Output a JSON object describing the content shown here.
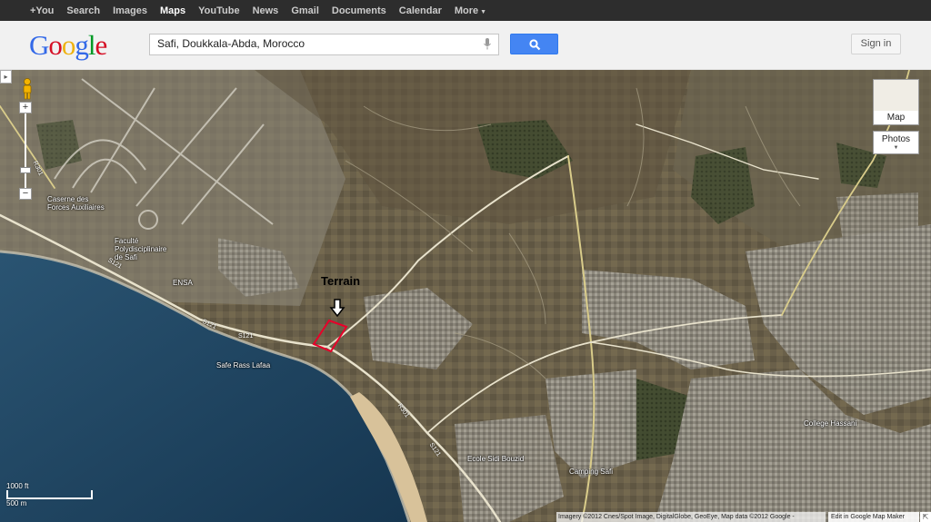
{
  "topbar": {
    "items": [
      "+You",
      "Search",
      "Images",
      "Maps",
      "YouTube",
      "News",
      "Gmail",
      "Documents",
      "Calendar",
      "More"
    ],
    "active": "Maps"
  },
  "header": {
    "logo_letters": [
      {
        "ch": "G",
        "color": "#3369e8"
      },
      {
        "ch": "o",
        "color": "#d50f25"
      },
      {
        "ch": "o",
        "color": "#eeb211"
      },
      {
        "ch": "g",
        "color": "#3369e8"
      },
      {
        "ch": "l",
        "color": "#009925"
      },
      {
        "ch": "e",
        "color": "#d50f25"
      }
    ],
    "search_value": "Safi, Doukkala-Abda, Morocco",
    "signin_label": "Sign in"
  },
  "map": {
    "sidebar_toggle": "▸",
    "zoom_in": "+",
    "zoom_out": "−",
    "zoom_level_fraction": 0.78,
    "maptype_map_label": "Map",
    "maptype_photos_label": "Photos",
    "annotation": "Terrain",
    "places": {
      "caserne": "Caserne des\nForces Auxiliaires",
      "faculte": "Faculté\nPolydisciplinaire\nde Safi",
      "ensa": "ENSA",
      "rass_lafaa": "Safe Rass Lafaa",
      "college": "College Hassani",
      "ecole": "Ecole Sidi Bouzid",
      "camping": "Camping Safi"
    },
    "roads": [
      "R301",
      "S121",
      "S121",
      "S121",
      "R301",
      "S121"
    ],
    "scale_ft": "1000 ft",
    "scale_m": "500 m",
    "attribution": "Imagery ©2012 Cnes/Spot Image, DigitalGlobe, GeoEye, Map data ©2012 Google -",
    "maker_link": "Edit in Google Map Maker",
    "resize_icon": "⇱",
    "colors": {
      "sea": "#1d3f5c",
      "land": "#6f6650",
      "urban": "#8e8a80",
      "marker": "#e8002a"
    }
  }
}
